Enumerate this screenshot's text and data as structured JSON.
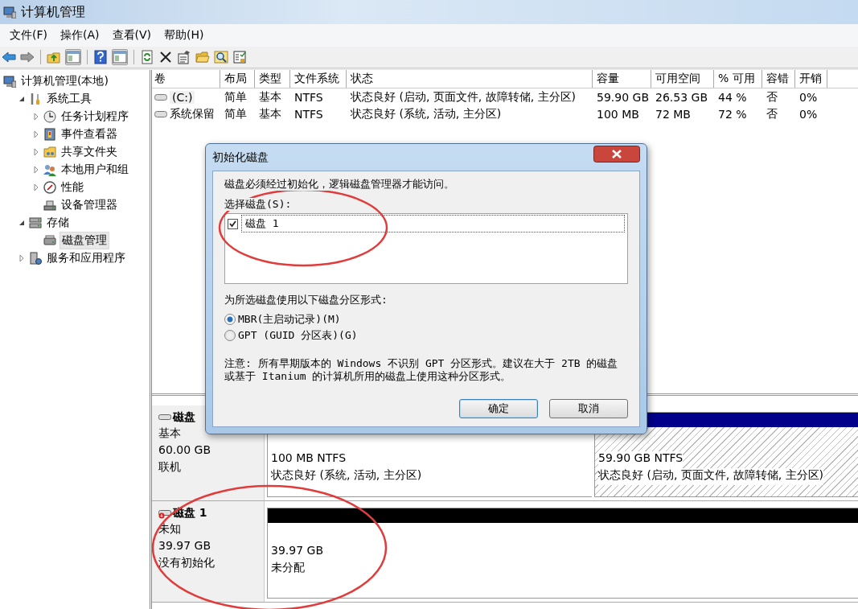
{
  "window": {
    "title": "计算机管理"
  },
  "menu": [
    "文件(F)",
    "操作(A)",
    "查看(V)",
    "帮助(H)"
  ],
  "toolbar": [
    {
      "kind": "back"
    },
    {
      "kind": "forward"
    },
    {
      "kind": "sep"
    },
    {
      "kind": "folder-up"
    },
    {
      "kind": "pane"
    },
    {
      "kind": "sep"
    },
    {
      "kind": "help"
    },
    {
      "kind": "pane"
    },
    {
      "kind": "sep"
    },
    {
      "kind": "refresh"
    },
    {
      "kind": "delete"
    },
    {
      "kind": "properties"
    },
    {
      "kind": "open-folder"
    },
    {
      "kind": "magnifier"
    },
    {
      "kind": "report"
    }
  ],
  "tree": [
    {
      "label": "计算机管理(本地)",
      "kind": "computer",
      "selected": false,
      "children": [
        {
          "label": "系统工具",
          "kind": "tools",
          "expanded": true,
          "selected": false,
          "children": [
            {
              "label": "任务计划程序",
              "kind": "clock",
              "expanded": false,
              "selected": false
            },
            {
              "label": "事件查看器",
              "kind": "event",
              "expanded": false,
              "selected": false
            },
            {
              "label": "共享文件夹",
              "kind": "share",
              "expanded": false,
              "selected": false
            },
            {
              "label": "本地用户和组",
              "kind": "users",
              "expanded": false,
              "selected": false
            },
            {
              "label": "性能",
              "kind": "performance",
              "expanded": false,
              "selected": false
            },
            {
              "label": "设备管理器",
              "kind": "device",
              "selected": false
            }
          ]
        },
        {
          "label": "存储",
          "kind": "storage",
          "expanded": true,
          "selected": false,
          "children": [
            {
              "label": "磁盘管理",
              "kind": "disk",
              "selected": true
            }
          ]
        },
        {
          "label": "服务和应用程序",
          "kind": "services",
          "expanded": false,
          "selected": false
        }
      ]
    }
  ],
  "volumes": {
    "columns": [
      "卷",
      "布局",
      "类型",
      "文件系统",
      "状态",
      "容量",
      "可用空间",
      "% 可用",
      "容错",
      "开销"
    ],
    "rows": [
      {
        "cells": [
          "(C:)",
          "简单",
          "基本",
          "NTFS",
          "状态良好 (启动, 页面文件, 故障转储, 主分区)",
          "59.90 GB",
          "26.53 GB",
          "44 %",
          "否",
          "0%"
        ],
        "selected": true
      },
      {
        "cells": [
          "系统保留",
          "简单",
          "基本",
          "NTFS",
          "状态良好 (系统, 活动, 主分区)",
          "100 MB",
          "72 MB",
          "72 %",
          "否",
          "0%"
        ],
        "selected": false
      }
    ]
  },
  "disks": [
    {
      "name": "磁盘",
      "type": "基本",
      "size": "60.00 GB",
      "status": "联机",
      "initialized": true,
      "circled": false,
      "partitions": [
        {
          "kind": "primary",
          "size": "100 MB NTFS",
          "status": "状态良好 (系统, 活动, 主分区)",
          "selected": false
        },
        {
          "kind": "primary",
          "size": "59.90 GB NTFS",
          "status": "状态良好 (启动, 页面文件, 故障转储, 主分区)",
          "selected": true
        }
      ]
    },
    {
      "name": "磁盘 1",
      "type": "未知",
      "size": "39.97 GB",
      "status": "没有初始化",
      "initialized": false,
      "circled": true,
      "partitions": [
        {
          "kind": "unallocated",
          "size": "39.97 GB",
          "status": "未分配",
          "selected": false
        }
      ]
    }
  ],
  "dialog": {
    "title": "初始化磁盘",
    "message": "磁盘必须经过初始化，逻辑磁盘管理器才能访问。",
    "list_label": "选择磁盘(S):",
    "disk_list": [
      {
        "label": "磁盘 1",
        "checked": true,
        "circled": true
      }
    ],
    "style_label": "为所选磁盘使用以下磁盘分区形式:",
    "options": [
      {
        "label": "MBR(主启动记录)(M)",
        "selected": true
      },
      {
        "label": "GPT (GUID 分区表)(G)",
        "selected": false
      }
    ],
    "note": "注意: 所有早期版本的 Windows 不识别 GPT 分区形式。建议在大于 2TB 的磁盘或基于 Itanium 的计算机所用的磁盘上使用这种分区形式。",
    "buttons": [
      {
        "label": "确定",
        "default": true
      },
      {
        "label": "取消",
        "default": false
      }
    ]
  }
}
